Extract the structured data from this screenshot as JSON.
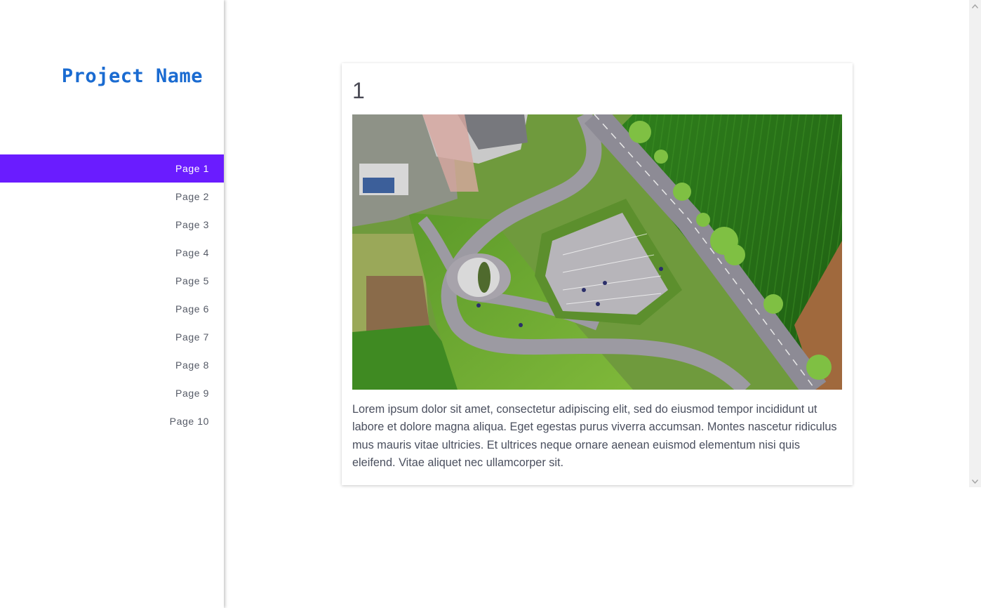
{
  "sidebar": {
    "project_name": "Project Name",
    "active_index": 0,
    "items": [
      {
        "label": "Page 1"
      },
      {
        "label": "Page 2"
      },
      {
        "label": "Page 3"
      },
      {
        "label": "Page 4"
      },
      {
        "label": "Page 5"
      },
      {
        "label": "Page 6"
      },
      {
        "label": "Page 7"
      },
      {
        "label": "Page 8"
      },
      {
        "label": "Page 9"
      },
      {
        "label": "Page 10"
      }
    ]
  },
  "card": {
    "title": "1",
    "image_name": "aerial-roundabout-photo",
    "text": "Lorem ipsum dolor sit amet, consectetur adipiscing elit, sed do eiusmod tempor incididunt ut labore et dolore magna aliqua. Eget egestas purus viverra accumsan. Montes nascetur ridiculus mus mauris vitae ultricies. Et ultrices neque ornare aenean euismod elementum nisi quis eleifend. Vitae aliquet nec ullamcorper sit."
  },
  "colors": {
    "accent": "#6a1cff",
    "project_name": "#1a6bd1",
    "nav_text": "#555a66"
  },
  "scrollbar": {
    "up_icon": "chevron-up-icon",
    "down_icon": "chevron-down-icon"
  }
}
